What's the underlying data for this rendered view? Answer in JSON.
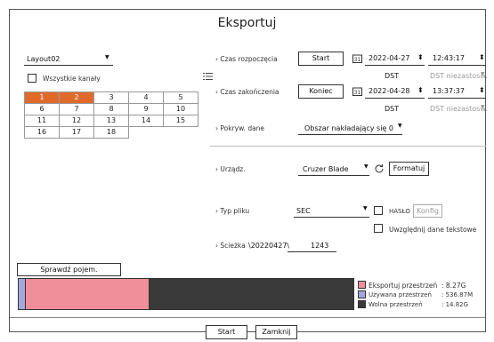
{
  "dialog": {
    "title": "Eksportuj"
  },
  "layout": {
    "selected": "Layout02",
    "all_channels_label": "Wszystkie kanały"
  },
  "channels": [
    {
      "label": "1",
      "selected": true
    },
    {
      "label": "2",
      "selected": true
    },
    {
      "label": "3",
      "selected": false
    },
    {
      "label": "4",
      "selected": false
    },
    {
      "label": "5",
      "selected": false
    },
    {
      "label": "6",
      "selected": false
    },
    {
      "label": "7",
      "selected": false
    },
    {
      "label": "8",
      "selected": false
    },
    {
      "label": "9",
      "selected": false
    },
    {
      "label": "10",
      "selected": false
    },
    {
      "label": "11",
      "selected": false
    },
    {
      "label": "12",
      "selected": false
    },
    {
      "label": "13",
      "selected": false
    },
    {
      "label": "14",
      "selected": false
    },
    {
      "label": "15",
      "selected": false
    },
    {
      "label": "16",
      "selected": false
    },
    {
      "label": "17",
      "selected": false
    },
    {
      "label": "18",
      "selected": false
    }
  ],
  "start": {
    "label": "Czas rozpoczęcia",
    "button": "Start",
    "date": "2022-04-27",
    "time": "12:43:17",
    "dst_label": "DST",
    "dst_value": "DST niezastosw."
  },
  "end": {
    "label": "Czas zakończenia",
    "button": "Koniec",
    "date": "2022-04-28",
    "time": "13:37:37",
    "dst_label": "DST",
    "dst_value": "DST niezastosw."
  },
  "overlap": {
    "label": "Pokryw. dane",
    "value": "Obszar nakładający się 0"
  },
  "device": {
    "label": "Urządz.",
    "value": "Cruzer Blade",
    "format_button": "Formatuj"
  },
  "filetype": {
    "label": "Typ pliku",
    "value": "SEC",
    "password_label": "HASŁO",
    "config_button": "Konfig",
    "include_text_label": "Uwzględnij dane tekstowe"
  },
  "path": {
    "label": "Ścieżka",
    "folder": "\\20220427\\",
    "name": "1243"
  },
  "capacity": {
    "check_button": "Sprawdź pojem.",
    "export_fraction": 0.37,
    "used_fraction": 0.02,
    "export_label": "Eksportuj przestrzeń",
    "export_value": ": 8.27G",
    "used_label": "Używana przestrzeń",
    "used_value": ": 536.87M",
    "free_label": "Wolna przestrzeń",
    "free_value": ": 14.82G",
    "colors": {
      "export": "#ee8f9a",
      "used": "#a3a7dc",
      "free": "#3a3a3a"
    }
  },
  "footer": {
    "start_button": "Start",
    "close_button": "Zamknij"
  },
  "icons": {
    "calendar": "calendar-icon",
    "refresh": "refresh-icon",
    "list": "list-icon"
  }
}
